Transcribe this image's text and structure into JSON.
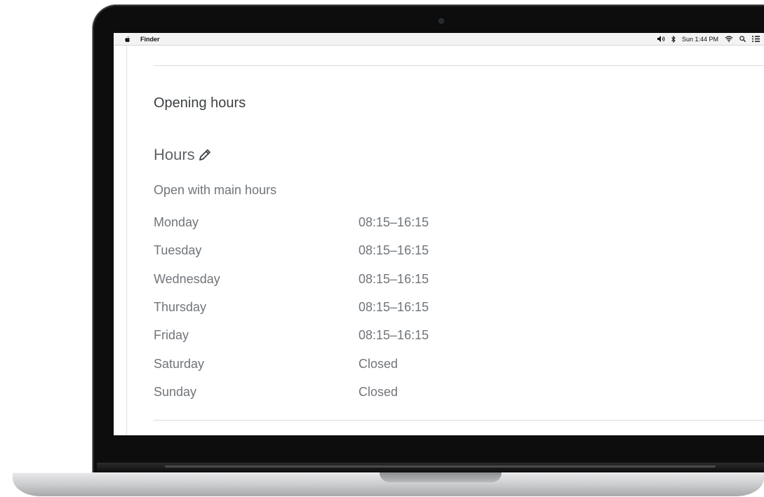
{
  "menubar": {
    "app_name": "Finder",
    "clock": "Sun 1:44 PM"
  },
  "icons": [
    "apple-icon",
    "volume-icon",
    "bluetooth-icon",
    "wifi-icon",
    "search-icon",
    "list-icon",
    "pencil-icon"
  ],
  "page": {
    "section_title": "Opening hours",
    "hours_title": "Hours",
    "subtitle": "Open with main hours",
    "schedule": [
      {
        "day": "Monday",
        "time": "08:15–16:15"
      },
      {
        "day": "Tuesday",
        "time": "08:15–16:15"
      },
      {
        "day": "Wednesday",
        "time": "08:15–16:15"
      },
      {
        "day": "Thursday",
        "time": "08:15–16:15"
      },
      {
        "day": "Friday",
        "time": "08:15–16:15"
      },
      {
        "day": "Saturday",
        "time": "Closed"
      },
      {
        "day": "Sunday",
        "time": "Closed"
      }
    ]
  }
}
